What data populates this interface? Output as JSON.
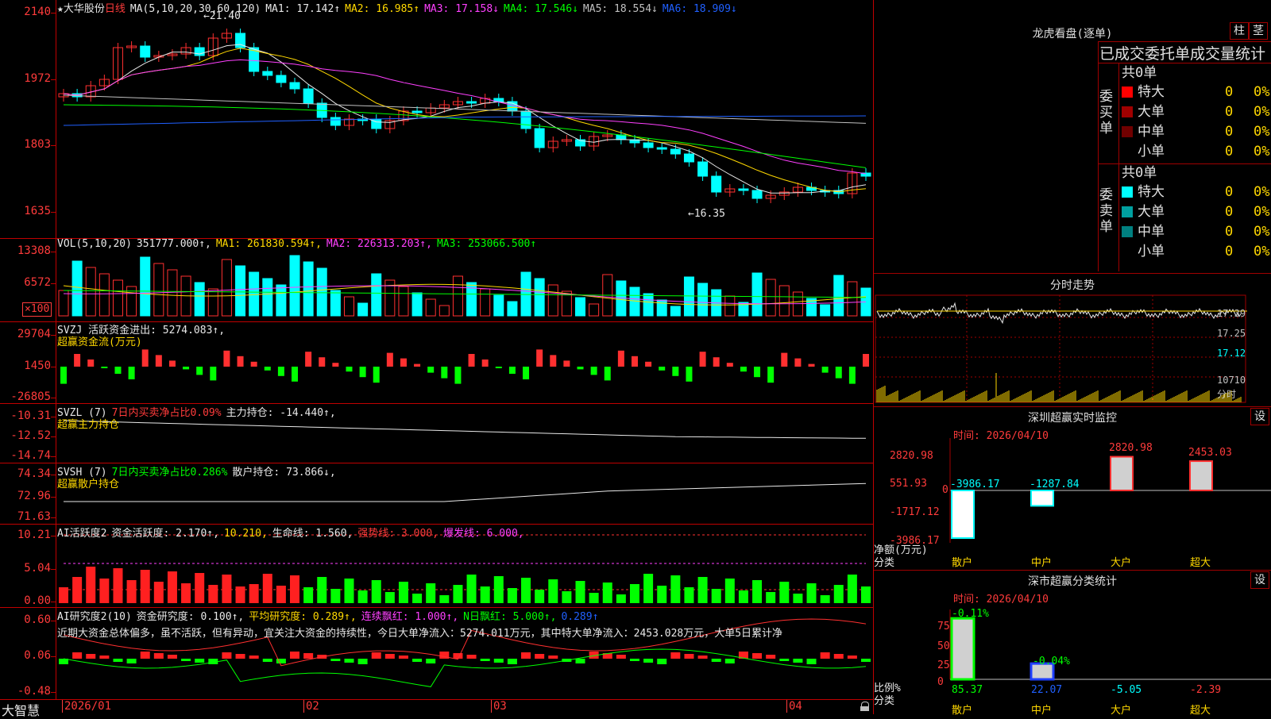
{
  "main_chart": {
    "stock_name": "大华股份",
    "period": "日线",
    "ma_title": "MA(5,10,20,30,60,120)",
    "ma_values": [
      {
        "label": "MA1: 17.142↑",
        "color": "#e8e8e8"
      },
      {
        "label": "MA2: 16.985↑",
        "color": "#ffd800"
      },
      {
        "label": "MA3: 17.158↓",
        "color": "#ff40ff"
      },
      {
        "label": "MA4: 17.546↓",
        "color": "#00ff00"
      },
      {
        "label": "MA5: 18.554↓",
        "color": "#c0c0c0"
      },
      {
        "label": "MA6: 18.909↓",
        "color": "#2060ff"
      }
    ],
    "y_ticks": [
      "2140",
      "1972",
      "1803",
      "1635"
    ],
    "high_mark": "21.40",
    "low_mark": "16.35"
  },
  "vol_panel": {
    "title": "VOL(5,10,20)",
    "values": [
      {
        "label": "351777.000↑,",
        "color": "#e8e8e8"
      },
      {
        "label": "MA1: 261830.594↑,",
        "color": "#ffd800"
      },
      {
        "label": "MA2: 226313.203↑,",
        "color": "#ff40ff"
      },
      {
        "label": "MA3: 253066.500↑",
        "color": "#00ff00"
      }
    ],
    "y_ticks": [
      "13308",
      "6572"
    ],
    "unit": "×100"
  },
  "svzj_panel": {
    "title": "SVZJ  活跃资金进出: 5274.083↑,",
    "subtitle": "超赢资金流(万元)",
    "y_ticks": [
      "29704",
      "1450",
      "-26805"
    ]
  },
  "svzl_panel": {
    "title_a": "SVZL (7)",
    "title_b": "7日内买卖净占比0.09%",
    "title_c": "主力持仓: -14.440↑,",
    "subtitle": "超赢主力持仓",
    "y_ticks": [
      "-10.31",
      "-12.52",
      "-14.74"
    ]
  },
  "svsh_panel": {
    "title_a": "SVSH (7)",
    "title_b": "7日内买卖净占比0.286%",
    "title_c": "散户持仓: 73.866↓,",
    "subtitle": "超赢散户持仓",
    "y_ticks": [
      "74.34",
      "72.96",
      "71.63"
    ]
  },
  "ai_active_panel": {
    "parts": [
      {
        "label": "AI活跃度2",
        "color": "#e8e8e8"
      },
      {
        "label": "资金活跃度: 2.170↑,",
        "color": "#e8e8e8"
      },
      {
        "label": "10.210,",
        "color": "#ffd800"
      },
      {
        "label": "生命线: 1.560,",
        "color": "#e8e8e8"
      },
      {
        "label": "强势线: 3.000,",
        "color": "#ff3b3b"
      },
      {
        "label": "爆发线: 6.000,",
        "color": "#ff40ff"
      }
    ],
    "y_ticks": [
      "10.21",
      "5.04",
      "0.00"
    ]
  },
  "ai_research_panel": {
    "parts": [
      {
        "label": "AI研究度2(10)",
        "color": "#e8e8e8"
      },
      {
        "label": "资金研究度: 0.100↑,",
        "color": "#e8e8e8"
      },
      {
        "label": "平均研究度: 0.289↑,",
        "color": "#ffd800"
      },
      {
        "label": "连续飘红: 1.000↑,",
        "color": "#ff40ff"
      },
      {
        "label": "N日飘红: 5.000↑,",
        "color": "#00ff00"
      },
      {
        "label": "0.289↑",
        "color": "#2060ff"
      }
    ],
    "comment": "近期大资金总体偏多，虽不活跃，但有异动，宜关注大资金的持续性，今日大单净流入：5274.011万元，其中特大单净流入：2453.028万元，大单5日累计净",
    "y_ticks": [
      "0.60",
      "0.06",
      "-0.48"
    ]
  },
  "bottom_bar": {
    "brand": "大智慧",
    "dates": [
      "2026/01",
      "02",
      "03",
      "04"
    ]
  },
  "right_panel": {
    "dragon_title": "龙虎看盘(逐单)",
    "btn_pillar": "柱",
    "btn_grid": "茎",
    "tabs": "已成交委托单成交量统计",
    "buy_label": "委买单",
    "sell_label": "委卖单",
    "buy_total": "共0单",
    "sell_total": "共0单",
    "buy_rows": [
      {
        "name": "特大",
        "count": "0",
        "pct": "0%",
        "color": "#ff0000"
      },
      {
        "name": "大单",
        "count": "0",
        "pct": "0%",
        "color": "#a00000"
      },
      {
        "name": "中单",
        "count": "0",
        "pct": "0%",
        "color": "#700000"
      },
      {
        "name": "小单",
        "count": "0",
        "pct": "0%",
        "color": ""
      }
    ],
    "sell_rows": [
      {
        "name": "特大",
        "count": "0",
        "pct": "0%",
        "color": "#00ffff"
      },
      {
        "name": "大单",
        "count": "0",
        "pct": "0%",
        "color": "#00a0a0"
      },
      {
        "name": "中单",
        "count": "0",
        "pct": "0%",
        "color": "#008080"
      },
      {
        "name": "小单",
        "count": "0",
        "pct": "0%",
        "color": ""
      }
    ],
    "intraday_title": "分时走势",
    "intraday_ticks": [
      "17.39",
      "17.25",
      "17.12",
      "10710",
      "分时"
    ],
    "sz_title": "深圳超赢实时监控",
    "sz_time": "时间: 2026/04/10",
    "sz_btn": "设",
    "sz_y_ticks": [
      "2820.98",
      "551.93",
      "0",
      "-1717.12",
      "-3986.17"
    ],
    "sz_values": [
      "-3986.17",
      "-1287.84",
      "2820.98",
      "2453.03"
    ],
    "sz_categories": [
      "散户",
      "中户",
      "大户",
      "超大"
    ],
    "sz_side_a": "净额(万元)",
    "sz_side_b": "分类",
    "ss_title": "深市超赢分类统计",
    "ss_time": "时间: 2026/04/10",
    "ss_btn": "设",
    "ss_y_ticks": [
      "75",
      "50",
      "25",
      "0"
    ],
    "ss_top_values": [
      "-0.11%",
      "-0.04%"
    ],
    "ss_values": [
      "85.37",
      "22.07",
      "-5.05",
      "-2.39"
    ],
    "ss_categories": [
      "散户",
      "中户",
      "大户",
      "超大"
    ],
    "ss_side_a": "比例%",
    "ss_side_b": "分类"
  }
}
